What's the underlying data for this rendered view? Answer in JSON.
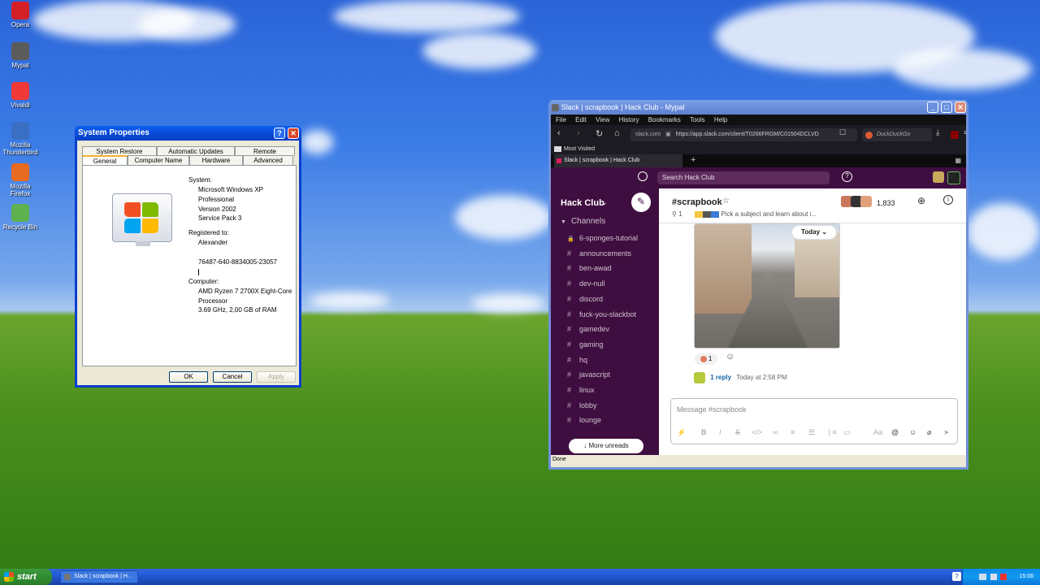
{
  "desktop": {
    "icons": [
      {
        "label": "Opera",
        "icon": "opera-icon",
        "color": "#d32027"
      },
      {
        "label": "Mypal",
        "icon": "mypal-icon",
        "color": "#5b5b5b"
      },
      {
        "label": "Vivaldi",
        "icon": "vivaldi-icon",
        "color": "#ef3939"
      },
      {
        "label": "Mozilla Thunderbird",
        "icon": "thunderbird-icon",
        "color": "#3a6fc4"
      },
      {
        "label": "Mozilla Firefox",
        "icon": "firefox-icon",
        "color": "#e66a1f"
      },
      {
        "label": "Recycle Bin",
        "icon": "recycle-bin-icon",
        "color": "#5fb04f"
      }
    ]
  },
  "sysprops": {
    "title": "System Properties",
    "tabs_row1": [
      "System Restore",
      "Automatic Updates",
      "Remote"
    ],
    "tabs_row2": [
      "General",
      "Computer Name",
      "Hardware",
      "Advanced"
    ],
    "system_label": "System:",
    "system_lines": [
      "Microsoft Windows XP",
      "Professional",
      "Version 2002",
      "Service Pack 3"
    ],
    "registered_label": "Registered to:",
    "registered_name": "Alexander",
    "product_id": "76487-640-8834005-23057",
    "computer_label": "Computer:",
    "computer_lines": [
      "AMD Ryzen 7 2700X Eight-Core",
      "Processor",
      "3.69 GHz, 2,00 GB of RAM"
    ],
    "ok": "OK",
    "cancel": "Cancel",
    "apply": "Apply"
  },
  "browser": {
    "title": "Slack | scrapbook | Hack Club - Mypal",
    "menu": [
      "File",
      "Edit",
      "View",
      "History",
      "Bookmarks",
      "Tools",
      "Help"
    ],
    "site_label": "slack.com",
    "url": "https://app.slack.com/client/T0266FRGM/C01504DCLVD",
    "search_placeholder": "DuckDuckGo",
    "bookmark": "Most Visited",
    "tab_title": "Slack | scrapbook | Hack Club",
    "status": "Done"
  },
  "slack": {
    "search": "Search Hack Club",
    "workspace": "Hack Club",
    "channels_header": "Channels",
    "channels": [
      "6-sponges-tutorial",
      "announcements",
      "ben-awad",
      "dev-null",
      "discord",
      "fuck-you-slackbot",
      "gamedev",
      "gaming",
      "hq",
      "javascript",
      "linux",
      "lobby",
      "lounge"
    ],
    "more_unreads": "More unreads",
    "channel_name": "#scrapbook",
    "pins": "1",
    "topic": "Pick a subject and learn about i...",
    "member_count": "1,833",
    "today": "Today",
    "reaction_count": "1",
    "reply_link": "1 reply",
    "reply_time": "Today at 2:58 PM",
    "composer_placeholder": "Message #scrapbook"
  },
  "taskbar": {
    "start": "start",
    "task": "Slack | scrapbook | H...",
    "clock": "15:06"
  }
}
